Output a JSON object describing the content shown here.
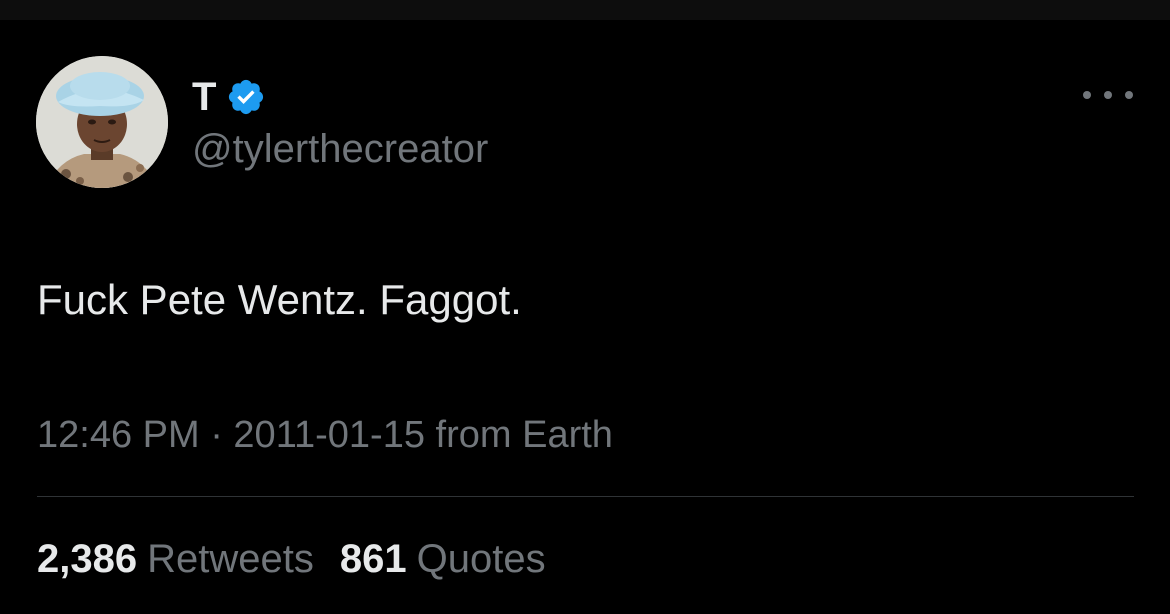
{
  "author": {
    "display_name": "T",
    "handle": "@tylerthecreator",
    "verified": true
  },
  "tweet": {
    "text": "Fuck Pete Wentz. Faggot.",
    "timestamp": "12:46 PM · 2011-01-15 from Earth"
  },
  "stats": {
    "retweets_count": "2,386",
    "retweets_label": "Retweets",
    "quotes_count": "861",
    "quotes_label": "Quotes"
  },
  "icons": {
    "verified": "verified-badge-icon",
    "more": "more-horizontal-icon"
  },
  "colors": {
    "background": "#000000",
    "primary_text": "#e7e9ea",
    "secondary_text": "#71767b",
    "verified_blue": "#1d9bf0",
    "divider": "#2f3336"
  }
}
